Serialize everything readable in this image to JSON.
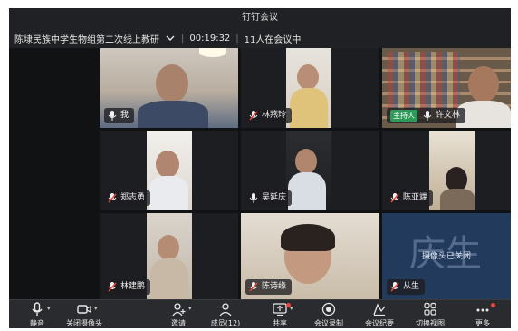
{
  "window": {
    "title": "钉钉会议"
  },
  "infobar": {
    "meeting_name": "陈埭民族中学生物组第二次线上教研",
    "duration": "00:19:32",
    "attendees": "11人在会议中"
  },
  "tiles": [
    {
      "name": "我",
      "muted": false,
      "host": false
    },
    {
      "name": "林燕玲",
      "muted": true,
      "host": false
    },
    {
      "name": "许文林",
      "muted": false,
      "host": true,
      "host_label": "主持人",
      "active": true
    },
    {
      "name": "郑志勇",
      "muted": true,
      "host": false
    },
    {
      "name": "吴延庆",
      "muted": false,
      "host": false
    },
    {
      "name": "陈亚端",
      "muted": true,
      "host": false
    },
    {
      "name": "林建鹏",
      "muted": true,
      "host": false
    },
    {
      "name": "陈诗缘",
      "muted": true,
      "host": false
    },
    {
      "name": "从生",
      "muted": true,
      "host": false,
      "camera_off_text": "摄像头已关闭",
      "avatar_text": "庆生"
    }
  ],
  "toolbar": {
    "items": [
      {
        "label": "静音",
        "icon": "mic-icon"
      },
      {
        "label": "关闭摄像头",
        "icon": "camera-icon"
      },
      {
        "label": "邀请",
        "icon": "add-user-icon"
      },
      {
        "label": "成员(12)",
        "icon": "members-icon"
      },
      {
        "label": "共享",
        "icon": "share-icon"
      },
      {
        "label": "会议录制",
        "icon": "record-icon"
      },
      {
        "label": "会议纪要",
        "icon": "notes-icon"
      },
      {
        "label": "切换视图",
        "icon": "grid-view-icon"
      },
      {
        "label": "更多",
        "icon": "more-icon"
      }
    ]
  },
  "colors": {
    "host_green": "#2e9a58",
    "active_border": "#3ac06f",
    "muted_red": "#e8483a",
    "camera_off_bg": "#223a5c"
  }
}
